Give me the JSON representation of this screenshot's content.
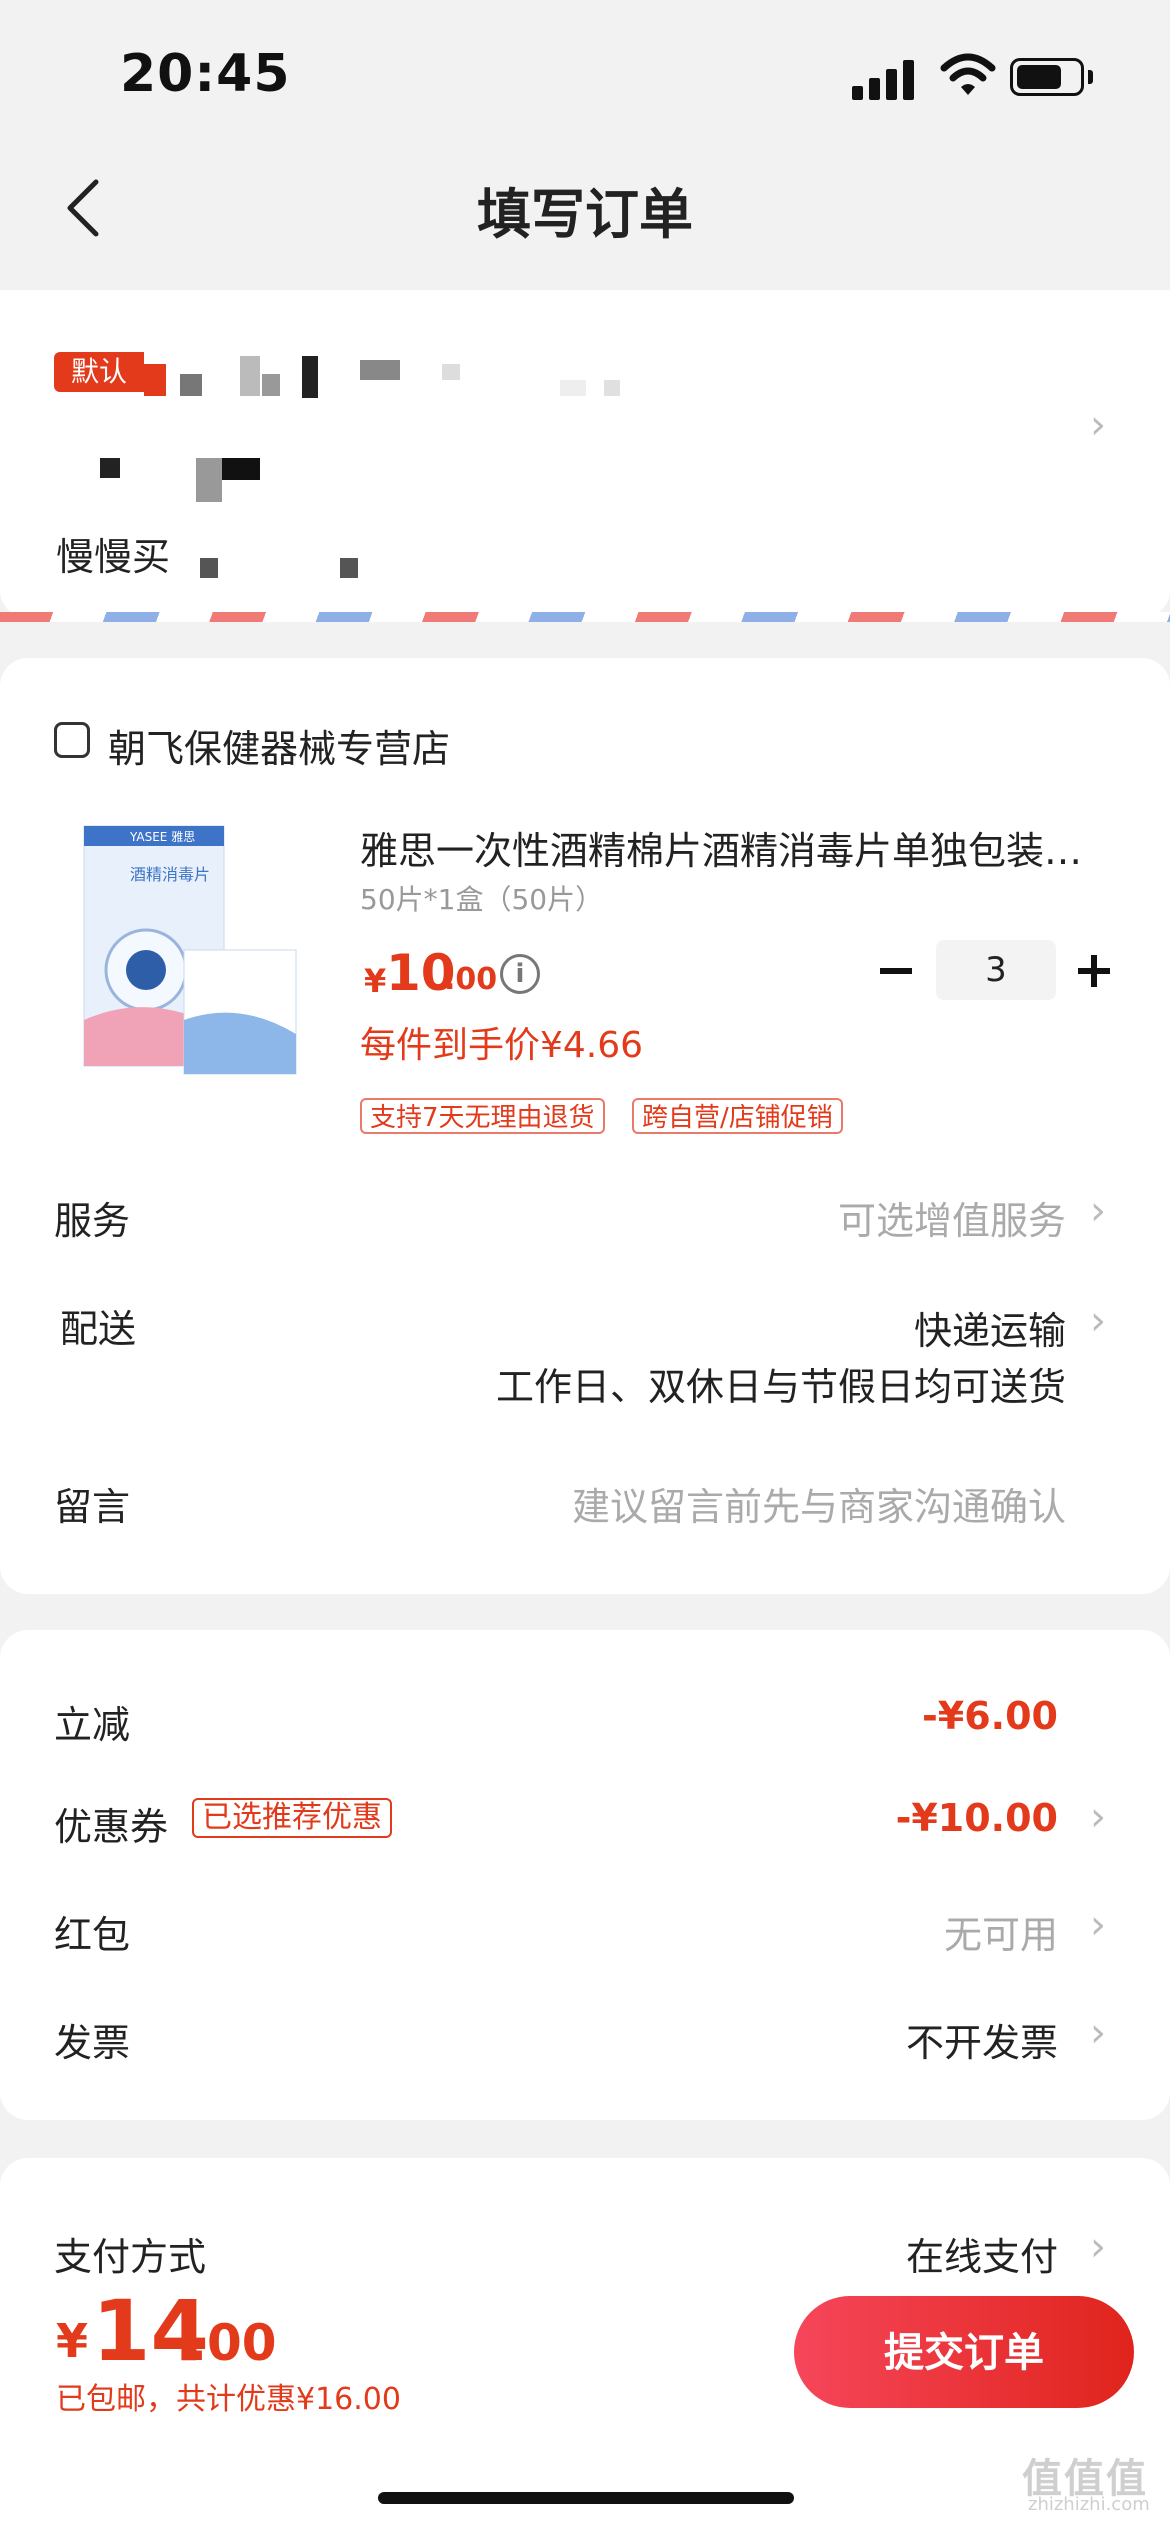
{
  "status_bar": {
    "time": "20:45"
  },
  "nav": {
    "title": "填写订单"
  },
  "address": {
    "default_tag": "默认",
    "name_line": "慢慢买"
  },
  "store": {
    "name": "朝飞保健器械专营店"
  },
  "product": {
    "title": "雅思一次性酒精棉片酒精消毒片单独包装…",
    "spec": "50片*1盒（50片）",
    "price_symbol": "¥",
    "price_int": "10",
    "price_dec": ".00",
    "final_price": "每件到手价¥4.66",
    "quantity": "3",
    "tags": [
      "支持7天无理由退货",
      "跨自营/店铺促销"
    ],
    "image_texts": {
      "brand": "YASEE 雅思",
      "box_label": "酒精消毒片"
    }
  },
  "rows": {
    "service": {
      "label": "服务",
      "value": "可选增值服务"
    },
    "delivery": {
      "label": "配送",
      "value": "快递运输",
      "sub": "工作日、双休日与节假日均可送货"
    },
    "message": {
      "label": "留言",
      "placeholder": "建议留言前先与商家沟通确认"
    }
  },
  "discounts": {
    "instant": {
      "label": "立减",
      "value": "-¥6.00"
    },
    "coupon": {
      "label": "优惠券",
      "tag": "已选推荐优惠",
      "value": "-¥10.00"
    },
    "redpacket": {
      "label": "红包",
      "value": "无可用"
    },
    "invoice": {
      "label": "发票",
      "value": "不开发票"
    }
  },
  "payment": {
    "label": "支付方式",
    "value": "在线支付"
  },
  "footer": {
    "total_symbol": "¥",
    "total_int": "14",
    "total_dec": ".00",
    "note": "已包邮，共计优惠¥16.00",
    "submit_label": "提交订单"
  },
  "watermark": {
    "main": "值值值",
    "sub": "zhizhizhi.com"
  },
  "colors": {
    "accent": "#e23a1a",
    "button_start": "#f6465a",
    "button_end": "#e0241c"
  }
}
